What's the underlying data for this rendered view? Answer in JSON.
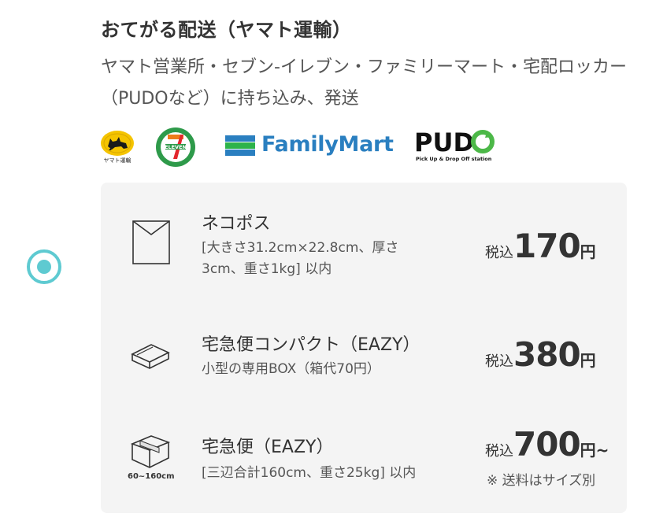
{
  "shipping": {
    "title": "おてがる配送（ヤマト運輸）",
    "description": "ヤマト営業所・セブン-イレブン・ファミリーマート・宅配ロッカー（PUDOなど）に持ち込み、発送",
    "selected": true,
    "accent_color": "#5ecad1"
  },
  "logos": {
    "yamato": {
      "icon": "yamato-cat-logo",
      "text": "ヤマト運輸"
    },
    "seven": {
      "icon": "seven-eleven-logo",
      "text": "7 ELEVEn"
    },
    "familymart": {
      "icon": "familymart-logo",
      "text": "FamilyMart"
    },
    "pudo": {
      "icon": "pudo-logo",
      "text": "PUDO",
      "sub": "Pick Up & Drop Off station"
    }
  },
  "options": [
    {
      "icon": "envelope-icon",
      "name": "ネコポス",
      "detail": "[大きさ31.2cm×22.8cm、厚さ3cm、重さ1kg] 以内",
      "price_prefix": "税込",
      "price": "170",
      "price_suffix": "円"
    },
    {
      "icon": "compact-box-icon",
      "name": "宅急便コンパクト（EAZY）",
      "detail": "小型の専用BOX（箱代70円）",
      "price_prefix": "税込",
      "price": "380",
      "price_suffix": "円"
    },
    {
      "icon": "parcel-box-icon",
      "icon_caption": "60~160cm",
      "name": "宅急便（EAZY）",
      "detail": "[三辺合計160cm、重さ25kg] 以内",
      "price_prefix": "税込",
      "price": "700",
      "price_suffix": "円~",
      "price_note": "※ 送料はサイズ別"
    }
  ]
}
